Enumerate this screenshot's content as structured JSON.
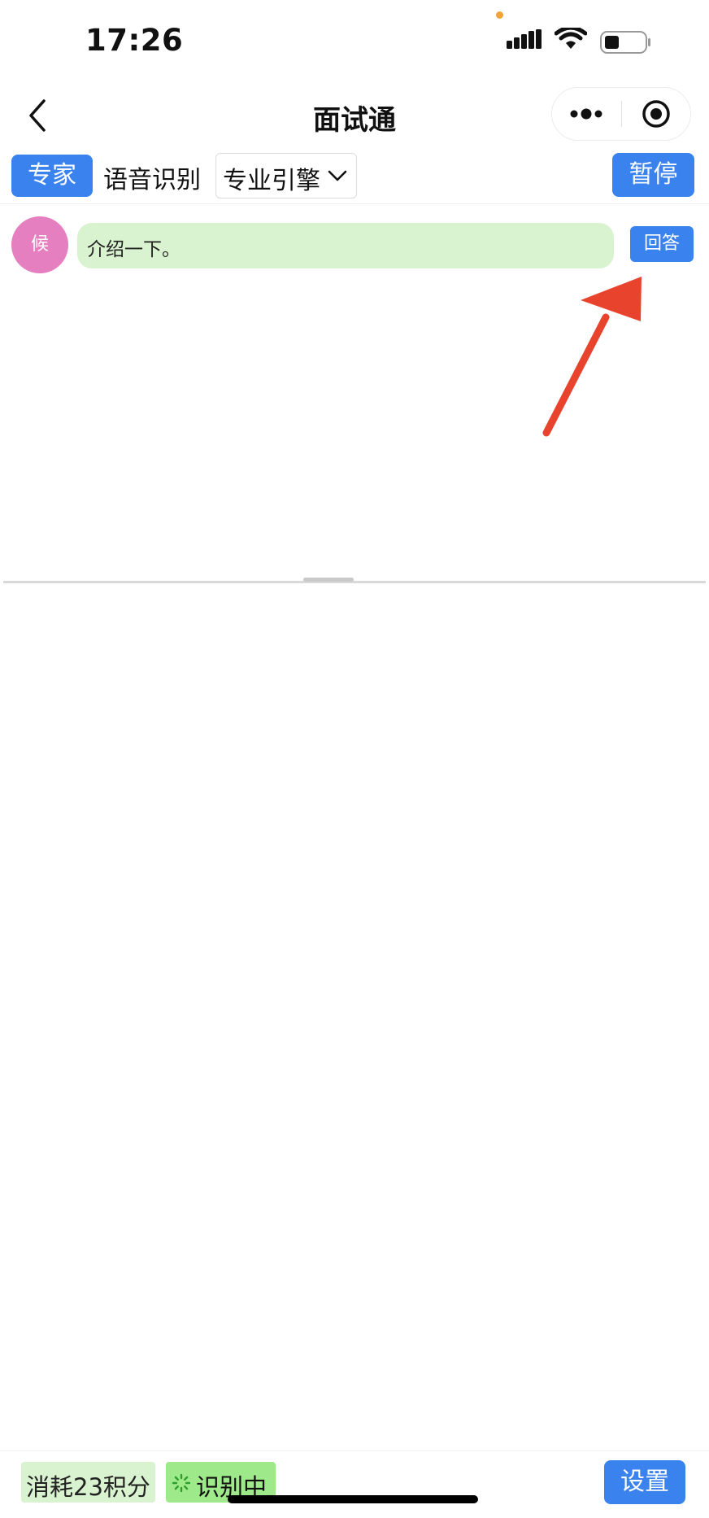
{
  "status_bar": {
    "time": "17:26",
    "icons": [
      "signal-icon",
      "wifi-icon",
      "battery-icon"
    ]
  },
  "nav": {
    "title": "面试通",
    "icons": [
      "back-icon",
      "more-icon",
      "close-mini-program-icon"
    ]
  },
  "toolbar": {
    "expert_label": "专家",
    "asr_label": "语音识别",
    "engine_value": "专业引擎",
    "pause_label": "暂停"
  },
  "messages": [
    {
      "avatar_text": "候",
      "text": "介绍一下。",
      "answer_label": "回答"
    }
  ],
  "footer": {
    "points_text": "消耗23积分",
    "recognizing_text": "识别中",
    "settings_label": "设置"
  },
  "colors": {
    "accent": "#3a82ee",
    "bubble": "#d9f2cf",
    "avatar": "#e57fbf",
    "recognizing": "#9eea8a",
    "annotation_arrow": "#e8432d"
  }
}
